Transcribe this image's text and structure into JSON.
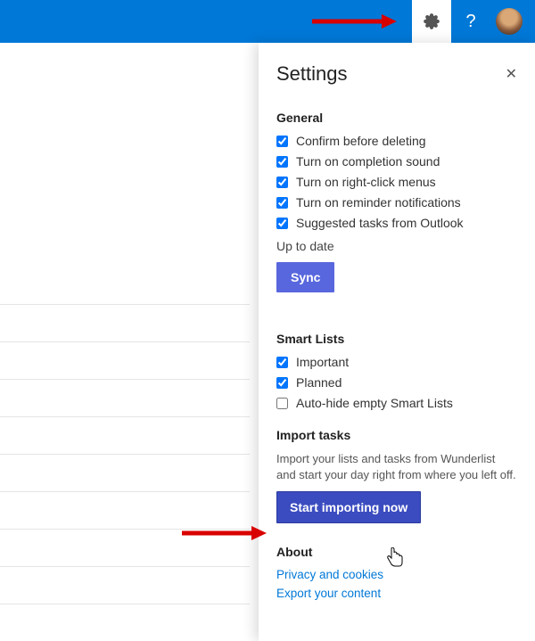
{
  "panel": {
    "title": "Settings",
    "general": {
      "heading": "General",
      "options": [
        {
          "label": "Confirm before deleting",
          "checked": true
        },
        {
          "label": "Turn on completion sound",
          "checked": true
        },
        {
          "label": "Turn on right-click menus",
          "checked": true
        },
        {
          "label": "Turn on reminder notifications",
          "checked": true
        },
        {
          "label": "Suggested tasks from Outlook",
          "checked": true
        }
      ],
      "status": "Up to date",
      "sync_label": "Sync"
    },
    "smartLists": {
      "heading": "Smart Lists",
      "options": [
        {
          "label": "Important",
          "checked": true
        },
        {
          "label": "Planned",
          "checked": true
        },
        {
          "label": "Auto-hide empty Smart Lists",
          "checked": false
        }
      ]
    },
    "import": {
      "heading": "Import tasks",
      "description": "Import your lists and tasks from Wunderlist and start your day right from where you left off.",
      "button_label": "Start importing now"
    },
    "about": {
      "heading": "About",
      "links": [
        "Privacy and cookies",
        "Export your content"
      ]
    }
  }
}
